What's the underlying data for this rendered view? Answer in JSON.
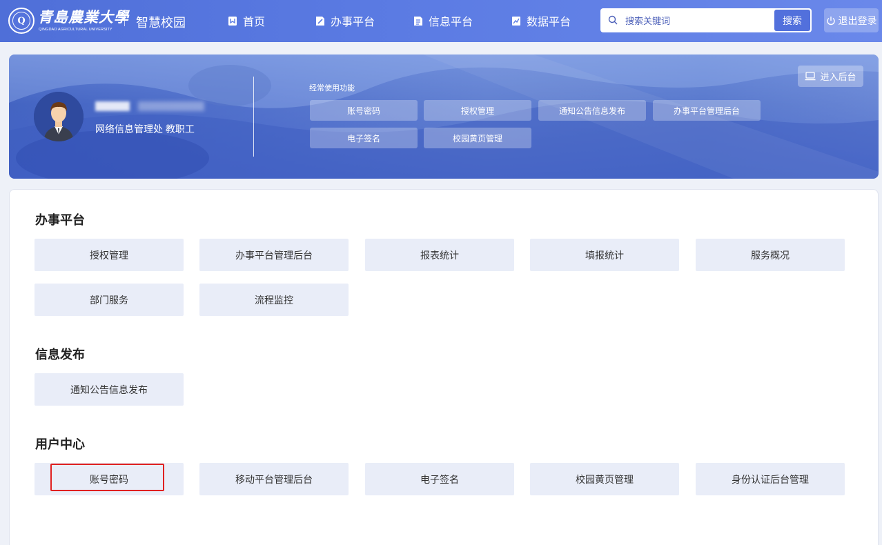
{
  "header": {
    "logo_cn": "青島農業大學",
    "logo_en": "QINGDAO AGRICULTURAL UNIVERSITY",
    "site_name": "智慧校园",
    "nav": [
      {
        "label": "首页",
        "icon": "home-book-icon"
      },
      {
        "label": "办事平台",
        "icon": "document-edit-icon"
      },
      {
        "label": "信息平台",
        "icon": "document-list-icon"
      },
      {
        "label": "数据平台",
        "icon": "chart-doc-icon"
      }
    ],
    "search_placeholder": "搜索关键词",
    "search_button": "搜索",
    "logout": "退出登录"
  },
  "profile": {
    "department": "网络信息管理处  教职工",
    "frequent_title": "经常使用功能",
    "frequent": [
      "账号密码",
      "授权管理",
      "通知公告信息发布",
      "办事平台管理后台",
      "电子签名",
      "校园黄页管理"
    ],
    "admin_button": "进入后台"
  },
  "sections": [
    {
      "title": "办事平台",
      "items": [
        "授权管理",
        "办事平台管理后台",
        "报表统计",
        "填报统计",
        "服务概况",
        "部门服务",
        "流程监控"
      ]
    },
    {
      "title": "信息发布",
      "items": [
        "通知公告信息发布"
      ]
    },
    {
      "title": "用户中心",
      "items": [
        "账号密码",
        "移动平台管理后台",
        "电子签名",
        "校园黄页管理",
        "身份认证后台管理"
      ]
    }
  ],
  "colors": {
    "nav_bg": "#5b7be3",
    "accent": "#5270dc",
    "tile_bg": "#e9edf8",
    "highlight": "#e02020"
  }
}
